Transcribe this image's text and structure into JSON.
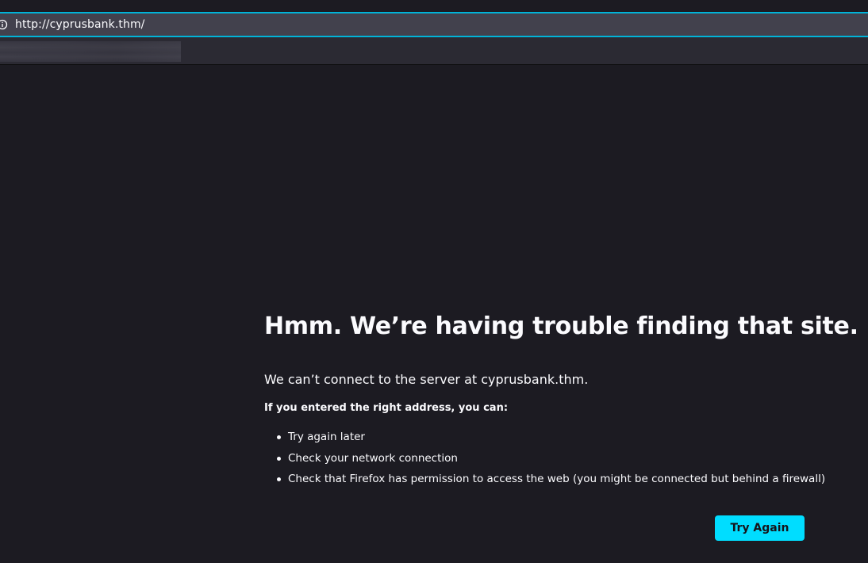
{
  "browser": {
    "url": "http://cyprusbank.thm/",
    "url_icon": "info-icon",
    "accent_color": "#00b3d8"
  },
  "error_page": {
    "title": "Hmm. We’re having trouble finding that site.",
    "short_desc": "We can’t connect to the server at cyprusbank.thm.",
    "long_title": "If you entered the right address, you can:",
    "suggestions": [
      "Try again later",
      "Check your network connection",
      "Check that Firefox has permission to access the web (you might be connected but behind a firewall)"
    ],
    "button_label": "Try Again",
    "button_color": "#00ddff",
    "background_color": "#1c1b22"
  }
}
